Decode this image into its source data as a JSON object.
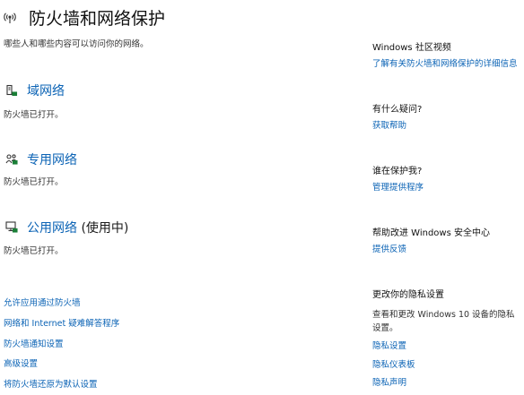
{
  "header": {
    "title": "防火墙和网络保护",
    "subtitle": "哪些人和哪些内容可以访问你的网络。"
  },
  "networks": [
    {
      "name": "域网络",
      "suffix": "",
      "status": "防火墙已打开。",
      "icon": "domain-network-icon"
    },
    {
      "name": "专用网络",
      "suffix": "",
      "status": "防火墙已打开。",
      "icon": "private-network-icon"
    },
    {
      "name": "公用网络",
      "suffix": " (使用中)",
      "status": "防火墙已打开。",
      "icon": "public-network-icon"
    }
  ],
  "links": [
    "允许应用通过防火墙",
    "网络和 Internet 疑难解答程序",
    "防火墙通知设置",
    "高级设置",
    "将防火墙还原为默认设置"
  ],
  "side": {
    "video_title": "Windows 社区视频",
    "video_link": "了解有关防火墙和网络保护的详细信息",
    "question_title": "有什么疑问?",
    "question_link": "获取帮助",
    "protect_title": "谁在保护我?",
    "protect_link": "管理提供程序",
    "improve_title": "帮助改进 Windows 安全中心",
    "improve_link": "提供反馈",
    "privacy_title": "更改你的隐私设置",
    "privacy_text": "查看和更改 Windows 10 设备的隐私",
    "privacy_text2": "设置。",
    "privacy_links": [
      "隐私设置",
      "隐私仪表板",
      "隐私声明"
    ]
  },
  "colors": {
    "accent": "#0b63b5",
    "background": "#ffffff"
  }
}
